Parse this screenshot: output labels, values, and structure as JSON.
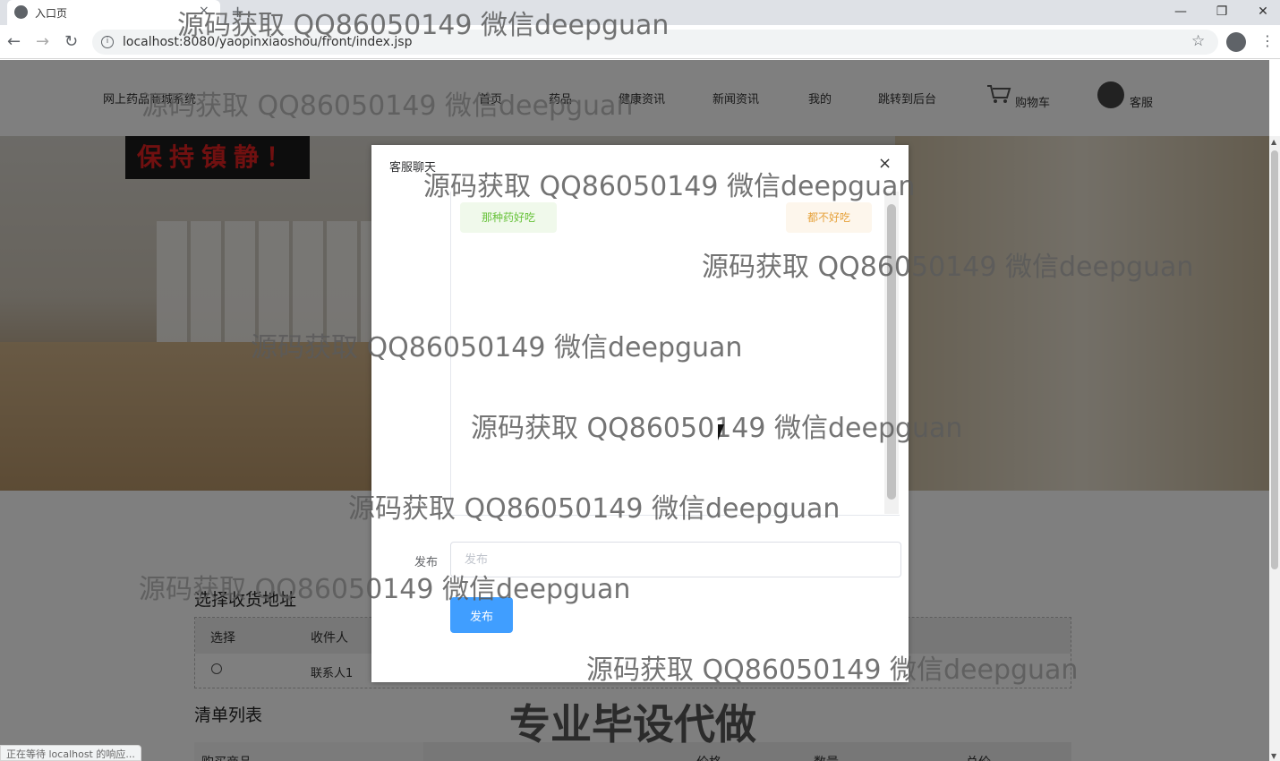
{
  "browser": {
    "tab_title": "入口页",
    "tab_close": "×",
    "new_tab": "+",
    "url": "localhost:8080/yaopinxiaoshou/front/index.jsp",
    "buttons": {
      "back": "←",
      "forward": "→",
      "reload": "↻",
      "star": "☆",
      "menu": "⋮",
      "minimize": "—",
      "restore": "❐",
      "close": "✕"
    },
    "status_text": "正在等待 localhost 的响应..."
  },
  "site": {
    "logo_text": "网上药品商城系统",
    "nav": [
      {
        "label": "首页"
      },
      {
        "label": "药品"
      },
      {
        "label": "健康资讯"
      },
      {
        "label": "新闻资讯"
      },
      {
        "label": "我的"
      },
      {
        "label": "跳转到后台"
      }
    ],
    "cart_label": "购物车",
    "kefu_label": "客服"
  },
  "hero": {
    "sign_text": "保持镇静！"
  },
  "address_section": {
    "title": "选择收货地址",
    "columns": [
      "选择",
      "收件人"
    ],
    "rows": [
      {
        "recipient": "联系人1"
      }
    ]
  },
  "order_section": {
    "title": "清单列表",
    "columns": [
      "购买商品",
      "价格",
      "数量",
      "总价"
    ]
  },
  "dialog": {
    "title": "客服聊天",
    "close_glyph": "×",
    "messages": [
      {
        "side": "left",
        "text": "那种药好吃"
      },
      {
        "side": "right",
        "text": "都不好吃"
      }
    ],
    "form_label": "发布",
    "input_placeholder": "发布",
    "submit_label": "发布"
  },
  "watermarks": {
    "text": "源码获取 QQ86050149 微信deepguan",
    "banner": "专业毕设代做"
  },
  "icons": {
    "cart": "cart-icon",
    "kefu": "wechat-icon",
    "info": "info-icon",
    "profile": "account-circle-icon"
  },
  "colors": {
    "primary_button": "#409eff",
    "msg_left_bg": "#f0f9eb",
    "msg_left_text": "#67c23a",
    "msg_right_bg": "#fdf6ec",
    "msg_right_text": "#e6a23c",
    "mask": "rgba(0,0,0,0.5)"
  }
}
